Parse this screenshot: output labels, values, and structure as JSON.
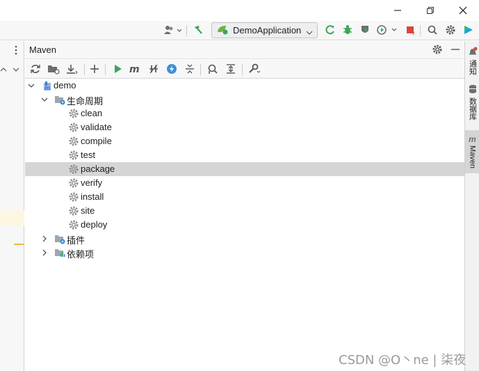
{
  "main_toolbar": {
    "run_config_label": "DemoApplication"
  },
  "maven_panel": {
    "title": "Maven",
    "tree": {
      "root": "demo",
      "lifecycle_label": "生命周期",
      "lifecycle": [
        "clean",
        "validate",
        "compile",
        "test",
        "package",
        "verify",
        "install",
        "site",
        "deploy"
      ],
      "selected": "package",
      "plugins_label": "插件",
      "dependencies_label": "依赖项"
    }
  },
  "right_strip": {
    "notifications": "通知",
    "database": "数据库",
    "maven": "Maven",
    "maven_glyph": "m"
  },
  "watermark": "CSDN @O丶ne | 柒夜",
  "colors": {
    "selection": "#d5d5d5",
    "run_green": "#3aa55a",
    "stop_red": "#d9453b",
    "icon_gray": "#6e6e6e",
    "module_blue": "#3d7dd8"
  },
  "icons": [
    "minimize-icon",
    "restore-icon",
    "close-icon",
    "user-icon",
    "build-hammer-icon",
    "spring-icon",
    "rerun-icon",
    "debug-icon",
    "coverage-icon",
    "profile-icon",
    "stop-icon",
    "search-icon",
    "settings-icon",
    "jetbrains-icon"
  ]
}
